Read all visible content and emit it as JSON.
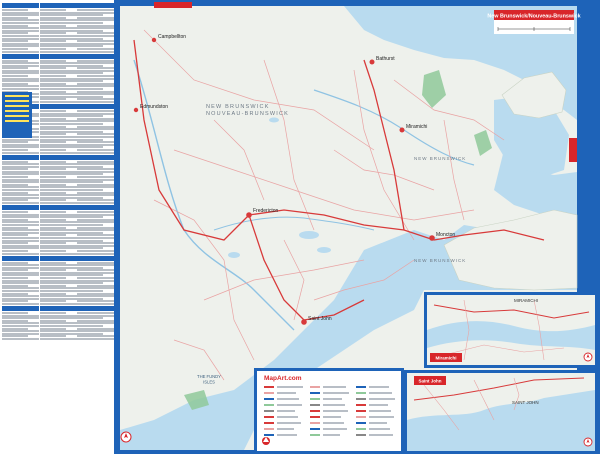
{
  "map": {
    "title": "New Brunswick/Nouveau-Brunswick",
    "region_label": "NEW BRUNSWICK\nNOUVEAU-BRUNSWICK",
    "region_label_east": "NEW BRUNSWICK",
    "region_label_south": "NEW BRUNSWICK",
    "water_label": "THE FUNDY\nISLES",
    "places": {
      "bathurst": "Bathurst",
      "miramichi": "Miramichi",
      "moncton": "Moncton",
      "fredericton": "Fredericton",
      "saint_john": "Saint John",
      "edmundston": "Edmundston",
      "campbellton": "Campbellton"
    },
    "colors": {
      "land": "#eef1ec",
      "water": "#b9dbef",
      "frame": "#1e63b8",
      "highway": "#d83a3a",
      "road": "#e9a3a3",
      "park": "#8fc99a",
      "title_bg": "#d8262a"
    }
  },
  "insets": {
    "miramichi": {
      "title": "Miramichi",
      "label": "MIRAMICHI"
    },
    "saint_john": {
      "title": "Saint John",
      "label": "SAINT JOHN"
    }
  },
  "legend": {
    "brand": "MapArt.com"
  },
  "icons": {
    "compass": "compass-icon",
    "logo": "mapart-logo-icon"
  }
}
